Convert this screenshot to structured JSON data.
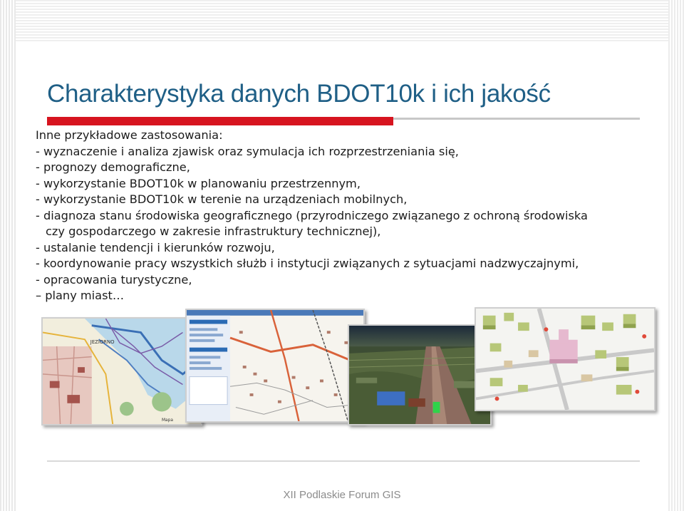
{
  "slide": {
    "title": "Charakterystyka danych BDOT10k i ich jakość",
    "lines": [
      "Inne przykładowe zastosowania:",
      "- wyznaczenie i analiza zjawisk oraz symulacja ich rozprzestrzeniania się,",
      "- prognozy demograficzne,",
      "- wykorzystanie BDOT10k w planowaniu przestrzennym,",
      "- wykorzystanie BDOT10k w terenie na urządzeniach mobilnych,",
      "- diagnoza stanu środowiska geograficznego (przyrodniczego związanego z ochroną środowiska",
      "czy gospodarczego w zakresie infrastruktury technicznej),",
      "- ustalanie tendencji i kierunków rozwoju,",
      "- koordynowanie pracy wszystkich służb i instytucji związanych z sytuacjami nadzwyczajnymi,",
      "- opracowania turystyczne,",
      "– plany miast…"
    ],
    "footer": "XII Podlaskie Forum GIS"
  },
  "images": {
    "map1_label": "JEZIORNO",
    "map1_scale": "Mapa"
  },
  "colors": {
    "title": "#1f5f86",
    "accent_red": "#d7141f",
    "footer": "#8c8c8c"
  }
}
